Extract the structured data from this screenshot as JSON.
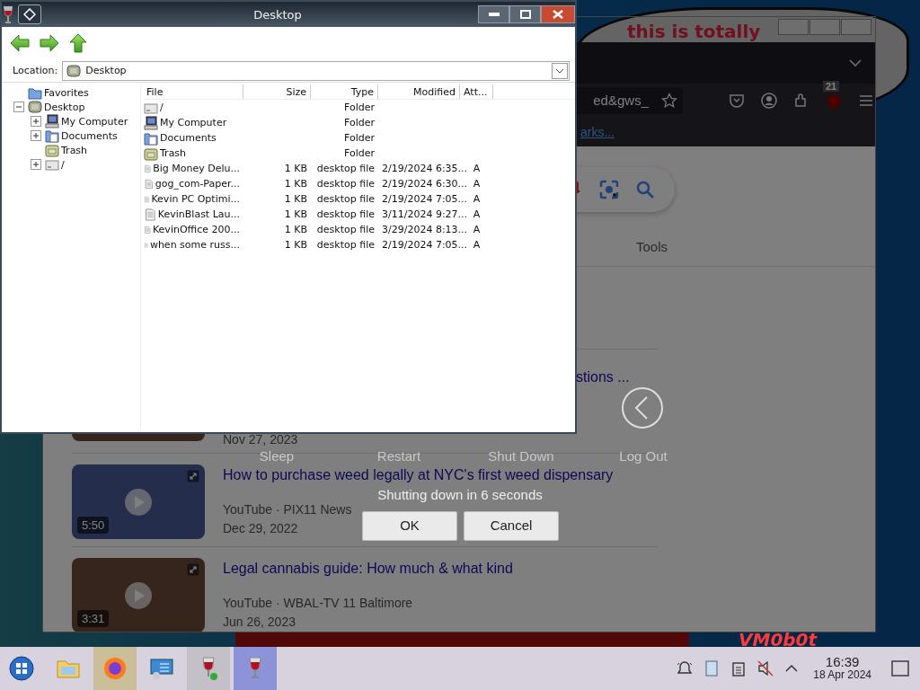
{
  "desktop": {
    "bubble_text": "this is totally",
    "corner_text": "VM0b0t"
  },
  "browser": {
    "url_text": "ed&gws_",
    "bookmark_link": "arks...",
    "extension_badge": "21",
    "tools_label": "Tools",
    "results": [
      {
        "kind": "partial",
        "title": "stions ...",
        "date": "Nov 27, 2023"
      },
      {
        "kind": "video",
        "title": "How to purchase weed legally at NYC's first weed dispensary",
        "source": "YouTube · PIX11 News",
        "date": "Dec 29, 2022",
        "duration": "5:50"
      },
      {
        "kind": "video",
        "title": "Legal cannabis guide: How much & what kind",
        "source": "YouTube · WBAL-TV 11 Baltimore",
        "date": "Jun 26, 2023",
        "duration": "3:31"
      }
    ]
  },
  "logout": {
    "options": [
      {
        "kind": "sleep",
        "label": "Sleep"
      },
      {
        "kind": "restart",
        "label": "Restart"
      },
      {
        "kind": "shutdown",
        "label": "Shut Down"
      },
      {
        "kind": "logout",
        "label": "Log Out"
      }
    ],
    "message": "Shutting down in 6 seconds",
    "buttons": [
      "OK",
      "Cancel"
    ]
  },
  "file_manager": {
    "title": "Desktop",
    "location_label": "Location:",
    "location": "Desktop",
    "tree": [
      {
        "label": "Favorites",
        "kind": "favorites",
        "has_children": false,
        "expanded": false
      },
      {
        "label": "Desktop",
        "kind": "desktop",
        "has_children": true,
        "expanded": true,
        "children": [
          {
            "label": "My Computer",
            "kind": "computer",
            "has_children": true,
            "expanded": false
          },
          {
            "label": "Documents",
            "kind": "documents",
            "has_children": true,
            "expanded": false
          },
          {
            "label": "Trash",
            "kind": "trash",
            "has_children": false,
            "expanded": false
          },
          {
            "label": "/",
            "kind": "drive",
            "has_children": true,
            "expanded": false
          }
        ]
      }
    ],
    "columns": [
      "File",
      "Size",
      "Type",
      "Modified",
      "Att..."
    ],
    "files": [
      {
        "kind": "drive",
        "name": "/",
        "type": "Folder"
      },
      {
        "kind": "computer",
        "name": "My Computer",
        "type": "Folder"
      },
      {
        "kind": "documents",
        "name": "Documents",
        "type": "Folder"
      },
      {
        "kind": "trash",
        "name": "Trash",
        "type": "Folder"
      },
      {
        "kind": "file",
        "name": "Big Money Delu...",
        "size": "1 KB",
        "type": "desktop file",
        "modified": "2/19/2024 6:35...",
        "attr": "A"
      },
      {
        "kind": "file",
        "name": "gog_com-Paper...",
        "size": "1 KB",
        "type": "desktop file",
        "modified": "2/19/2024 6:30...",
        "attr": "A"
      },
      {
        "kind": "file",
        "name": "Kevin PC Optimi...",
        "size": "1 KB",
        "type": "desktop file",
        "modified": "2/19/2024 7:05...",
        "attr": "A"
      },
      {
        "kind": "file",
        "name": "KevinBlast Lau...",
        "size": "1 KB",
        "type": "desktop file",
        "modified": "3/11/2024 9:27...",
        "attr": "A"
      },
      {
        "kind": "file",
        "name": "KevinOffice 200...",
        "size": "1 KB",
        "type": "desktop file",
        "modified": "3/29/2024 8:13...",
        "attr": "A"
      },
      {
        "kind": "file",
        "name": "when some russ...",
        "size": "1 KB",
        "type": "desktop file",
        "modified": "2/19/2024 7:05...",
        "attr": "A"
      }
    ]
  },
  "taskbar": {
    "apps": [
      {
        "kind": "start"
      },
      {
        "kind": "files"
      },
      {
        "kind": "firefox",
        "color": "#cbbf9a"
      },
      {
        "kind": "control-panel"
      },
      {
        "kind": "wine-installer",
        "color": "#c3c0c8"
      },
      {
        "kind": "wine",
        "color": "#8d93d8"
      }
    ],
    "clock": {
      "time": "16:39",
      "date": "18 Apr 2024"
    }
  }
}
